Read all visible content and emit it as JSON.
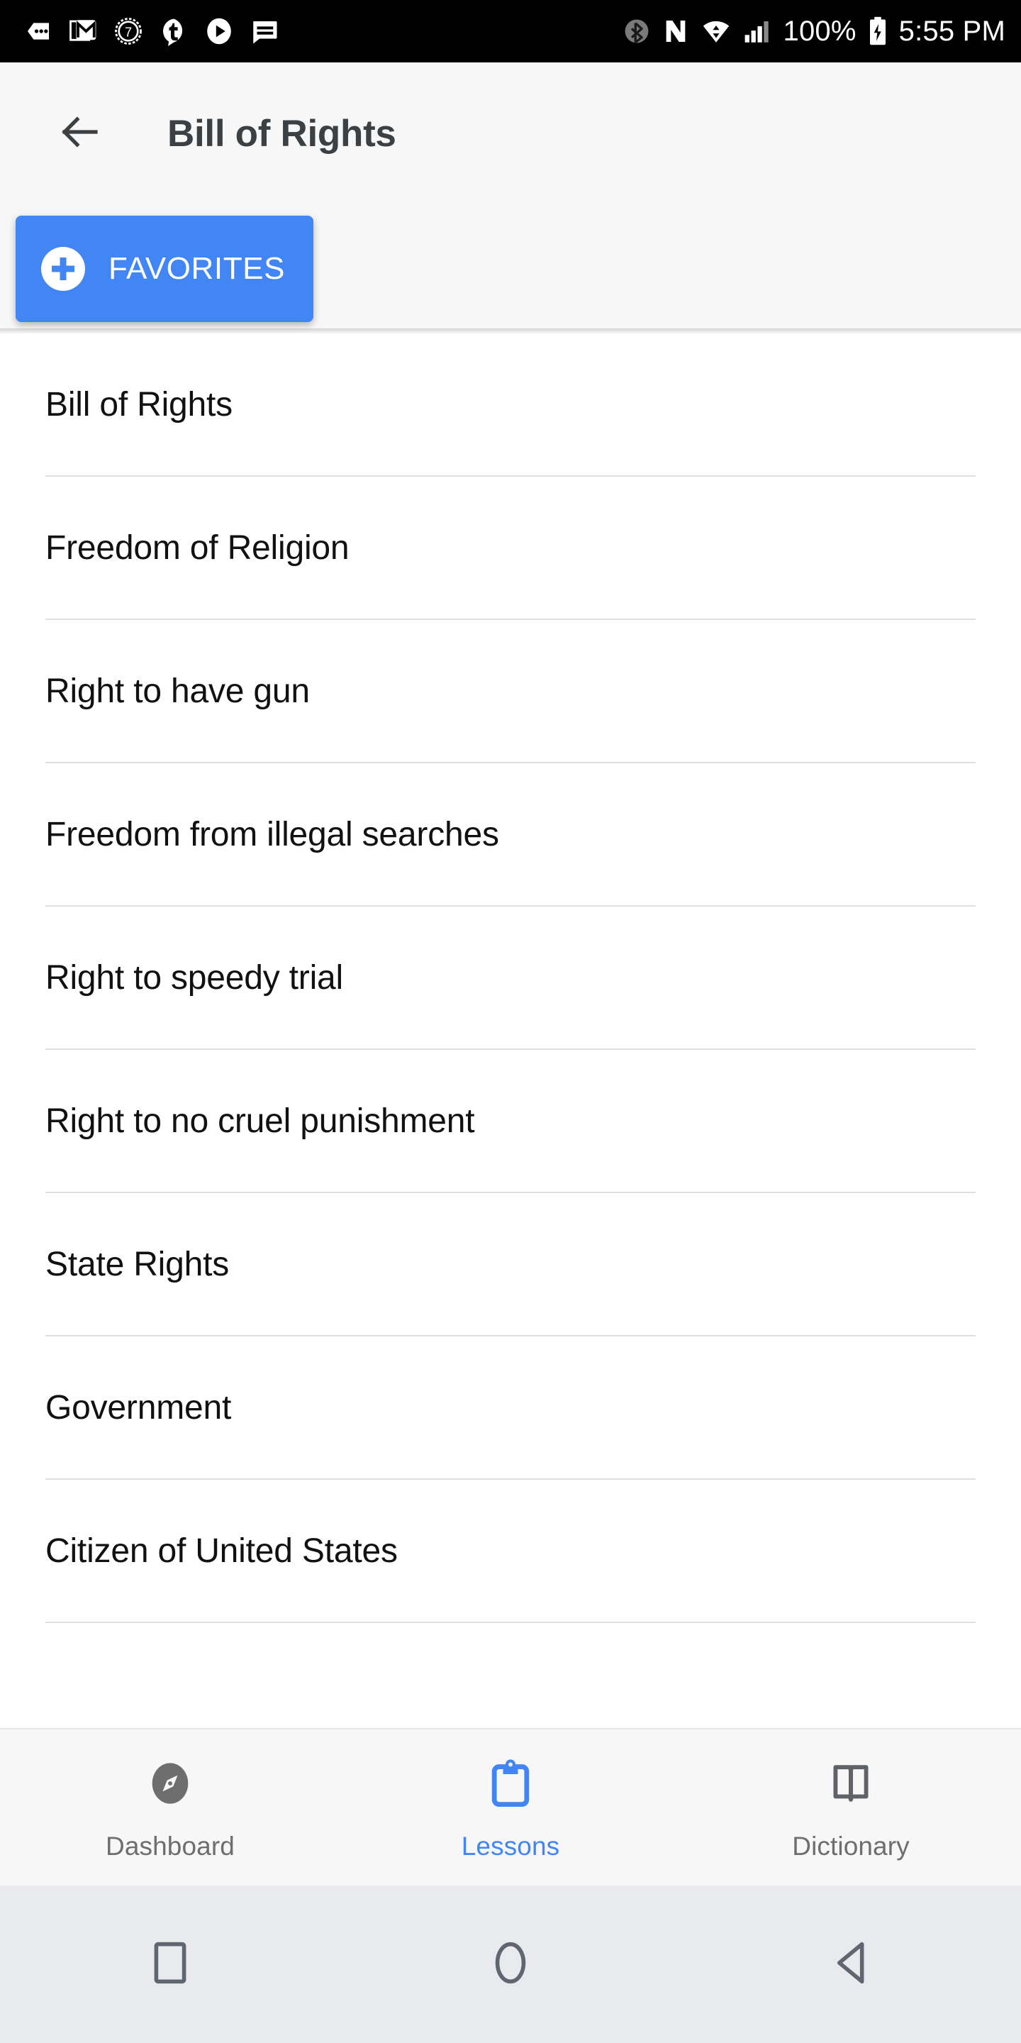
{
  "status_bar": {
    "background": "#000000",
    "notification_icons": [
      {
        "name": "more-notifications-icon"
      },
      {
        "name": "gmail-icon"
      },
      {
        "name": "seven-badge-icon"
      },
      {
        "name": "tumblr-icon"
      },
      {
        "name": "play-icon"
      },
      {
        "name": "message-icon"
      }
    ],
    "system_icons": [
      {
        "name": "bluetooth-icon"
      },
      {
        "name": "nfc-icon"
      },
      {
        "name": "wifi-icon"
      },
      {
        "name": "cellular-signal-icon"
      }
    ],
    "battery_percent": "100%",
    "battery_icon": "battery-charging-icon",
    "clock": "5:55 PM"
  },
  "appbar": {
    "back_icon": "arrow-back-icon",
    "title": "Bill of Rights",
    "background": "#f7f7f7",
    "title_color": "#3c4043"
  },
  "favorites": {
    "label": "FAVORITES",
    "icon": "add-circle-icon",
    "accent": "#4285f4"
  },
  "lessons_list": [
    {
      "label": "Bill of Rights"
    },
    {
      "label": "Freedom of Religion"
    },
    {
      "label": "Right to have gun"
    },
    {
      "label": "Freedom from illegal searches"
    },
    {
      "label": "Right to speedy trial"
    },
    {
      "label": "Right to no cruel punishment"
    },
    {
      "label": "State Rights"
    },
    {
      "label": "Government"
    },
    {
      "label": "Citizen of United States"
    }
  ],
  "tabbar": {
    "active_color": "#4285f4",
    "inactive_color": "#6e6e6e",
    "tabs": [
      {
        "label": "Dashboard",
        "icon": "compass-icon",
        "active": false
      },
      {
        "label": "Lessons",
        "icon": "clipboard-icon",
        "active": true
      },
      {
        "label": "Dictionary",
        "icon": "book-icon",
        "active": false
      }
    ]
  },
  "system_nav": {
    "background": "#e8eaed",
    "buttons": [
      {
        "name": "recents-square-icon"
      },
      {
        "name": "home-circle-icon"
      },
      {
        "name": "back-triangle-icon"
      }
    ]
  }
}
